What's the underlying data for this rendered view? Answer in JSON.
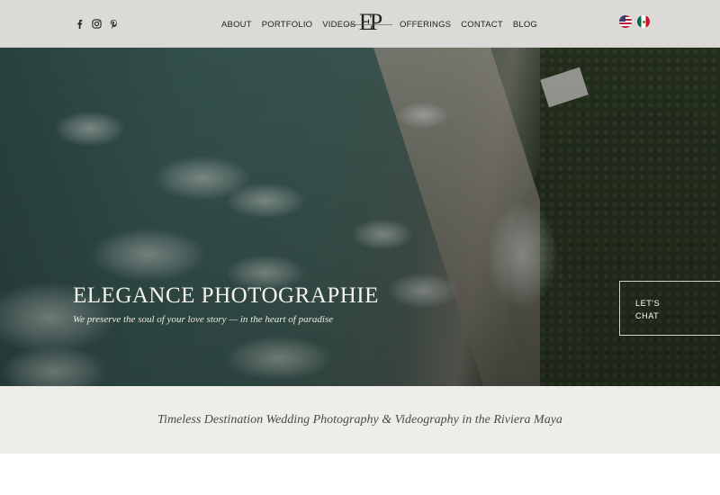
{
  "header": {
    "social": [
      "facebook-icon",
      "instagram-icon",
      "pinterest-icon"
    ],
    "nav_left": [
      "ABOUT",
      "PORTFOLIO",
      "VIDEOS"
    ],
    "nav_right": [
      "OFFERINGS",
      "CONTACT",
      "BLOG"
    ],
    "logo": {
      "monogram": "EP"
    },
    "languages": [
      "us-flag-icon",
      "mexico-flag-icon"
    ]
  },
  "hero": {
    "title": "ELEGANCE PHOTOGRAPHIE",
    "subtitle": "We preserve the soul of your love story — in the heart of paradise",
    "chat_line1": "LET'S",
    "chat_line2": "CHAT"
  },
  "tagline": "Timeless Destination Wedding Photography & Videography in the Riviera Maya",
  "colors": {
    "header_bg": "#dcdad6",
    "band_bg": "#efedea",
    "text_dark": "#222222"
  }
}
